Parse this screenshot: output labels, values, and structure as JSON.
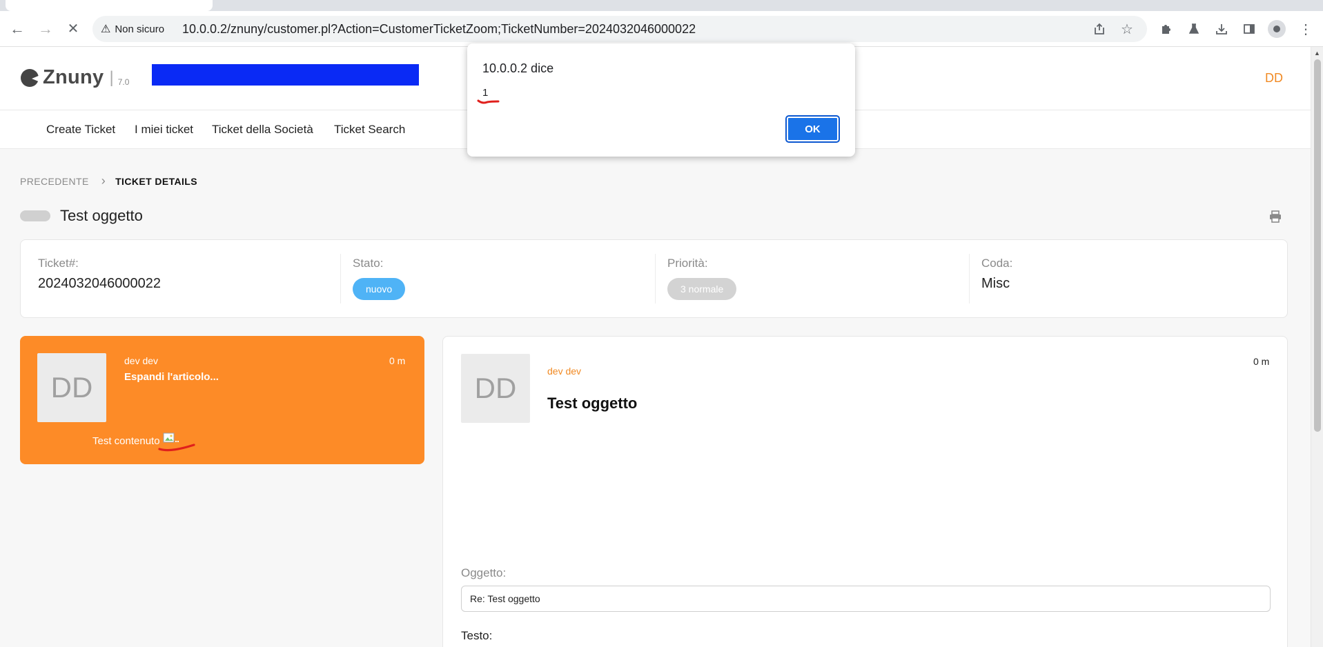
{
  "browser": {
    "security_label": "Non sicuro",
    "url": "10.0.0.2/znuny/customer.pl?Action=CustomerTicketZoom;TicketNumber=2024032046000022",
    "icons": [
      "back-icon",
      "forward-icon",
      "stop-loading-icon",
      "warning-icon",
      "share-icon",
      "bookmark-star-icon",
      "extensions-icon",
      "labs-icon",
      "download-icon",
      "side-panel-icon",
      "profile-icon",
      "menu-icon"
    ]
  },
  "header": {
    "logo_text": "Znuny",
    "logo_separator": "|",
    "logo_version": "7.0",
    "user_initials": "DD"
  },
  "nav": {
    "items": [
      {
        "label": "Create Ticket"
      },
      {
        "label": "I miei ticket"
      },
      {
        "label": "Ticket della Società"
      },
      {
        "label": "Ticket Search"
      }
    ]
  },
  "breadcrumb": {
    "previous": "PRECEDENTE",
    "current": "TICKET DETAILS"
  },
  "ticket": {
    "title": "Test oggetto",
    "number_label": "Ticket#:",
    "number": "2024032046000022",
    "state_label": "Stato:",
    "state": "nuovo",
    "priority_label": "Priorità:",
    "priority": "3 normale",
    "queue_label": "Coda:",
    "queue": "Misc"
  },
  "article_list": {
    "avatar": "DD",
    "author": "dev dev",
    "expand": "Espandi l'articolo...",
    "time": "0 m",
    "content": "Test contenuto"
  },
  "article_detail": {
    "avatar": "DD",
    "author": "dev dev",
    "subject": "Test oggetto",
    "time": "0 m",
    "subject_field_label": "Oggetto:",
    "subject_field_value": "Re: Test oggetto",
    "text_field_label": "Testo:"
  },
  "alert": {
    "title": "10.0.0.2 dice",
    "message": "1",
    "ok_label": "OK"
  },
  "colors": {
    "accent_orange": "#fd8b27",
    "state_blue": "#4fb3f6",
    "dialog_button": "#1a73e8",
    "redaction_blue": "#0a2af5",
    "annotation_red": "#e0201c"
  }
}
